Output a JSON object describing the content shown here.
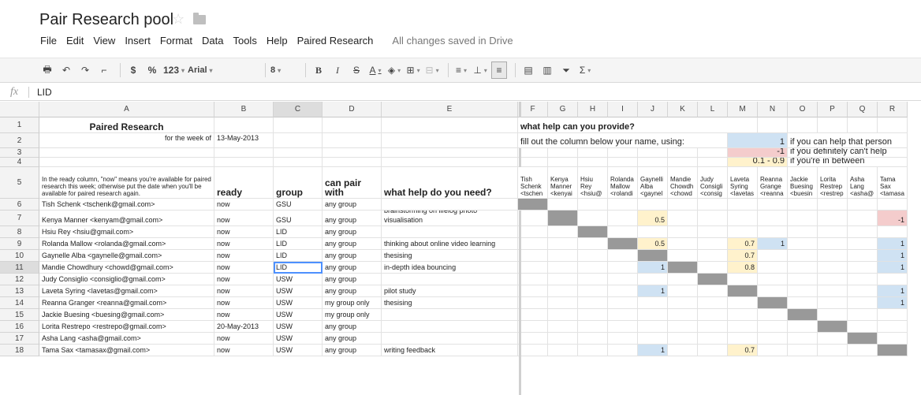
{
  "doc": {
    "title": "Pair Research pool"
  },
  "menu": [
    "File",
    "Edit",
    "View",
    "Insert",
    "Format",
    "Data",
    "Tools",
    "Help",
    "Paired Research"
  ],
  "save_status": "All changes saved in Drive",
  "toolbar": {
    "currency": "$",
    "percent": "%",
    "number_fmt": "123",
    "font": "Arial",
    "size": "8",
    "bold": "B",
    "italic": "I",
    "strike": "S",
    "textcolor": "A",
    "sum": "Σ"
  },
  "formula": {
    "fx": "fx",
    "value": "LID"
  },
  "columns": [
    "A",
    "B",
    "C",
    "D",
    "E",
    "F",
    "G",
    "H",
    "I",
    "J",
    "K",
    "L",
    "M",
    "N",
    "O",
    "P",
    "Q",
    "R"
  ],
  "selected_column": "C",
  "selected_row": "11",
  "rows": [
    "1",
    "2",
    "3",
    "4",
    "5",
    "6",
    "7",
    "8",
    "9",
    "10",
    "11",
    "12",
    "13",
    "14",
    "15",
    "16",
    "17",
    "18"
  ],
  "header": {
    "paired_research": "Paired Research",
    "for_week": "for the week of",
    "week_date": "13-May-2013",
    "what_help_provide": "what help can you provide?",
    "fill_out": "fill out the column below your name, using:",
    "legend_1_val": "1",
    "legend_1_text": "if you can help that person",
    "legend_2_val": "-1",
    "legend_2_text": "if you definitely can't help",
    "legend_3_val": "0.1 - 0.9",
    "legend_3_text": "if you're in between",
    "ready_note": "In the ready column, \"now\" means you're available for paired research this week; otherwise put the date when you'll be available for paired research again.",
    "col_ready": "ready",
    "col_group": "group",
    "col_can_pair": "can pair with",
    "col_help_need": "what help do you need?"
  },
  "name_headers": [
    "Tish Schenk <tschen",
    "Kenya Manner <kenyai",
    "Hsiu Rey <hsiu@",
    "Rolanda Mallow <rolandi",
    "Gaynelli Alba <gaynel",
    "Mandie Chowdh <chowd",
    "Judy Consigli <consig",
    "Laveta Syring <lavetas",
    "Reanna Grange <reanna",
    "Jackie Buesing <buesin",
    "Lorita Restrep <restrep",
    "Asha Lang <asha@",
    "Tama Sax <tamasa"
  ],
  "people": [
    {
      "name": "Tish Schenk <tschenk@gmail.com>",
      "ready": "now",
      "group": "GSU",
      "pair": "any group",
      "help": ""
    },
    {
      "name": "Kenya Manner <kenyam@gmail.com>",
      "ready": "now",
      "group": "GSU",
      "pair": "any group",
      "help": "brainstorming on lifelog photo visualisation"
    },
    {
      "name": "Hsiu Rey <hsiu@gmail.com>",
      "ready": "now",
      "group": "LID",
      "pair": "any group",
      "help": ""
    },
    {
      "name": "Rolanda Mallow <rolanda@gmail.com>",
      "ready": "now",
      "group": "LID",
      "pair": "any group",
      "help": "thinking about online video learning"
    },
    {
      "name": "Gaynelle Alba <gaynelle@gmail.com>",
      "ready": "now",
      "group": "LID",
      "pair": "any group",
      "help": "thesising"
    },
    {
      "name": "Mandie Chowdhury <chowd@gmail.com>",
      "ready": "now",
      "group": "LID",
      "pair": "any group",
      "help": "in-depth idea bouncing"
    },
    {
      "name": "Judy Consiglio <consiglio@gmail.com>",
      "ready": "now",
      "group": "USW",
      "pair": "any group",
      "help": ""
    },
    {
      "name": "Laveta Syring <lavetas@gmail.com>",
      "ready": "now",
      "group": "USW",
      "pair": "any group",
      "help": "pilot study"
    },
    {
      "name": "Reanna Granger <reanna@gmail.com>",
      "ready": "now",
      "group": "USW",
      "pair": "my group only",
      "help": "thesising"
    },
    {
      "name": "Jackie Buesing <buesing@gmail.com>",
      "ready": "now",
      "group": "USW",
      "pair": "my group only",
      "help": ""
    },
    {
      "name": "Lorita Restrepo <restrepo@gmail.com>",
      "ready": "20-May-2013",
      "group": "USW",
      "pair": "any group",
      "help": ""
    },
    {
      "name": "Asha Lang <asha@gmail.com>",
      "ready": "now",
      "group": "USW",
      "pair": "any group",
      "help": ""
    },
    {
      "name": "Tama Sax <tamasax@gmail.com>",
      "ready": "now",
      "group": "USW",
      "pair": "any group",
      "help": "writing feedback"
    }
  ],
  "matrix_values": [
    {
      "row": 1,
      "col": 4,
      "val": "0.5",
      "color": "yellow"
    },
    {
      "row": 1,
      "col": 12,
      "val": "-1",
      "color": "pink"
    },
    {
      "row": 3,
      "col": 4,
      "val": "0.5",
      "color": "yellow"
    },
    {
      "row": 3,
      "col": 7,
      "val": "0.7",
      "color": "yellow"
    },
    {
      "row": 3,
      "col": 8,
      "val": "1",
      "color": "blue"
    },
    {
      "row": 3,
      "col": 12,
      "val": "1",
      "color": "blue"
    },
    {
      "row": 4,
      "col": 7,
      "val": "0.7",
      "color": "yellow"
    },
    {
      "row": 4,
      "col": 12,
      "val": "1",
      "color": "blue"
    },
    {
      "row": 5,
      "col": 4,
      "val": "1",
      "color": "blue"
    },
    {
      "row": 5,
      "col": 7,
      "val": "0.8",
      "color": "yellow"
    },
    {
      "row": 5,
      "col": 12,
      "val": "1",
      "color": "blue"
    },
    {
      "row": 7,
      "col": 4,
      "val": "1",
      "color": "blue"
    },
    {
      "row": 7,
      "col": 12,
      "val": "1",
      "color": "blue"
    },
    {
      "row": 8,
      "col": 12,
      "val": "1",
      "color": "blue"
    },
    {
      "row": 12,
      "col": 4,
      "val": "1",
      "color": "blue"
    },
    {
      "row": 12,
      "col": 7,
      "val": "0.7",
      "color": "yellow"
    }
  ]
}
